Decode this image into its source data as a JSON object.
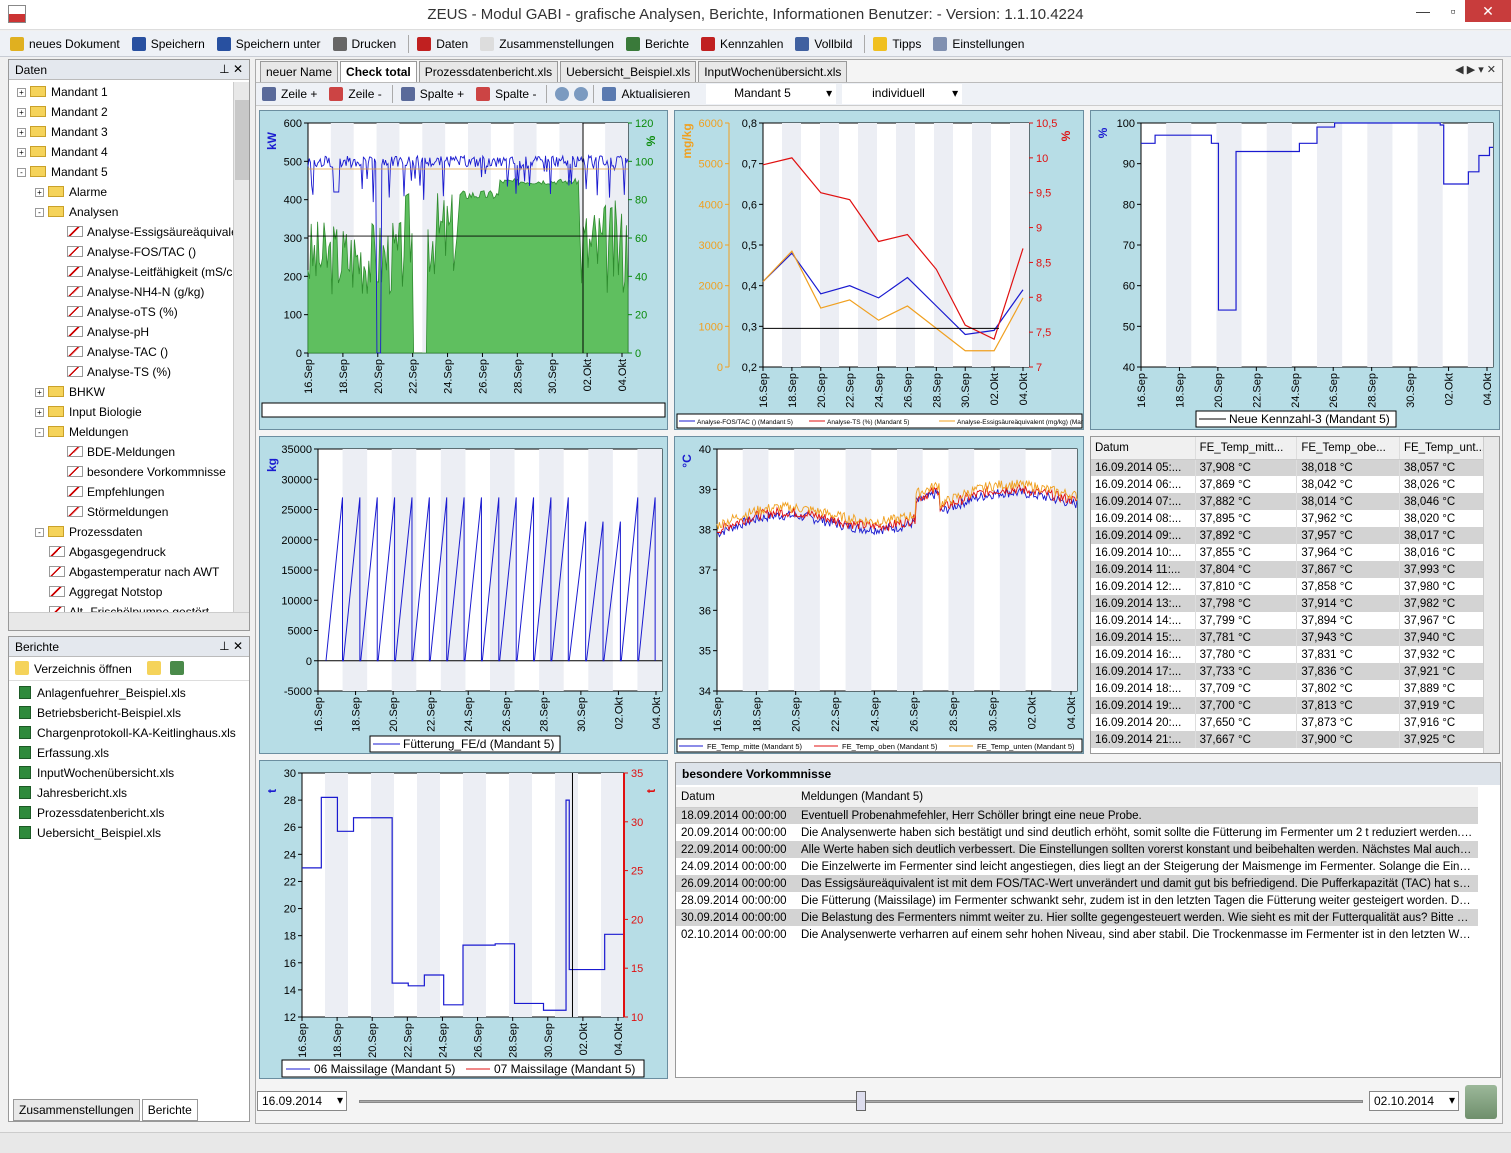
{
  "window": {
    "title": "ZEUS - Modul GABI - grafische Analysen, Berichte, Informationen Benutzer:  - Version: 1.1.10.4224"
  },
  "toolbar": [
    {
      "label": "neues Dokument",
      "color": "#e0b020"
    },
    {
      "label": "Speichern",
      "color": "#2850a0"
    },
    {
      "label": "Speichern unter",
      "color": "#2850a0"
    },
    {
      "label": "Drucken",
      "color": "#666"
    },
    {
      "label": "Daten",
      "color": "#c02020"
    },
    {
      "label": "Zusammenstellungen",
      "color": "#ddd"
    },
    {
      "label": "Berichte",
      "color": "#3a7a3a"
    },
    {
      "label": "Kennzahlen",
      "color": "#c02020"
    },
    {
      "label": "Vollbild",
      "color": "#4060a0"
    },
    {
      "label": "Tipps",
      "color": "#f0c020"
    },
    {
      "label": "Einstellungen",
      "color": "#8090b0"
    }
  ],
  "daten": {
    "title": "Daten",
    "items": [
      {
        "label": "Mandant 1",
        "lvl": 0,
        "type": "folder",
        "exp": "+"
      },
      {
        "label": "Mandant 2",
        "lvl": 0,
        "type": "folder",
        "exp": "+"
      },
      {
        "label": "Mandant 3",
        "lvl": 0,
        "type": "folder",
        "exp": "+"
      },
      {
        "label": "Mandant 4",
        "lvl": 0,
        "type": "folder",
        "exp": "+"
      },
      {
        "label": "Mandant 5",
        "lvl": 0,
        "type": "folder",
        "exp": "-"
      },
      {
        "label": "Alarme",
        "lvl": 1,
        "type": "folder",
        "exp": "+"
      },
      {
        "label": "Analysen",
        "lvl": 1,
        "type": "folder",
        "exp": "-"
      },
      {
        "label": "Analyse-Essigsäureäquivalent",
        "lvl": 2,
        "type": "chart"
      },
      {
        "label": "Analyse-FOS/TAC ()",
        "lvl": 2,
        "type": "chart"
      },
      {
        "label": "Analyse-Leitfähigkeit (mS/cm)",
        "lvl": 2,
        "type": "chart"
      },
      {
        "label": "Analyse-NH4-N (g/kg)",
        "lvl": 2,
        "type": "chart"
      },
      {
        "label": "Analyse-oTS (%)",
        "lvl": 2,
        "type": "chart"
      },
      {
        "label": "Analyse-pH",
        "lvl": 2,
        "type": "chart"
      },
      {
        "label": "Analyse-TAC ()",
        "lvl": 2,
        "type": "chart"
      },
      {
        "label": "Analyse-TS (%)",
        "lvl": 2,
        "type": "chart"
      },
      {
        "label": "BHKW",
        "lvl": 1,
        "type": "folder",
        "exp": "+"
      },
      {
        "label": "Input Biologie",
        "lvl": 1,
        "type": "folder",
        "exp": "+"
      },
      {
        "label": "Meldungen",
        "lvl": 1,
        "type": "folder",
        "exp": "-"
      },
      {
        "label": "BDE-Meldungen",
        "lvl": 2,
        "type": "chart"
      },
      {
        "label": "besondere Vorkommnisse",
        "lvl": 2,
        "type": "chart"
      },
      {
        "label": "Empfehlungen",
        "lvl": 2,
        "type": "chart"
      },
      {
        "label": "Störmeldungen",
        "lvl": 2,
        "type": "chart"
      },
      {
        "label": "Prozessdaten",
        "lvl": 1,
        "type": "folder",
        "exp": "-"
      },
      {
        "label": "Abgasgegendruck",
        "lvl": 1,
        "type": "chart"
      },
      {
        "label": "Abgastemperatur nach AWT",
        "lvl": 1,
        "type": "chart"
      },
      {
        "label": "Aggregat Notstop",
        "lvl": 1,
        "type": "chart"
      },
      {
        "label": "Alt- Frischölpumpe gestört",
        "lvl": 1,
        "type": "chart"
      }
    ]
  },
  "berichte": {
    "title": "Berichte",
    "open_label": "Verzeichnis öffnen",
    "files": [
      "Anlagenfuehrer_Beispiel.xls",
      "Betriebsbericht-Beispiel.xls",
      "Chargenprotokoll-KA-Keitlinghaus.xls",
      "Erfassung.xls",
      "InputWochenübersicht.xls",
      "Jahresbericht.xls",
      "Prozessdatenbericht.xls",
      "Uebersicht_Beispiel.xls"
    ],
    "bottom_tabs": [
      "Zusammenstellungen",
      "Berichte"
    ]
  },
  "doc_tabs": [
    "neuer Name",
    "Check total",
    "Prozessdatenbericht.xls",
    "Uebersicht_Beispiel.xls",
    "InputWochenübersicht.xls"
  ],
  "sub_toolbar": {
    "zeile_plus": "Zeile +",
    "zeile_minus": "Zeile -",
    "spalte_plus": "Spalte +",
    "spalte_minus": "Spalte -",
    "refresh": "Aktualisieren",
    "mandant": "Mandant 5",
    "mode": "individuell"
  },
  "chart_data": [
    {
      "type": "line",
      "title": "",
      "ylabel": "kW",
      "y2label": "%",
      "ylim": [
        0,
        600
      ],
      "y2lim": [
        0,
        120
      ],
      "x": [
        "16.Sep",
        "18.Sep",
        "20.Sep",
        "22.Sep",
        "24.Sep",
        "26.Sep",
        "28.Sep",
        "30.Sep",
        "02.Okt",
        "04.Okt"
      ],
      "yticks": [
        0,
        100,
        200,
        300,
        400,
        500,
        600
      ],
      "y2ticks": [
        0,
        20,
        40,
        60,
        80,
        100,
        120
      ]
    },
    {
      "type": "line",
      "ylabel": "mg/kg",
      "ylim": [
        0,
        6000
      ],
      "y2lim": [
        0.2,
        0.8
      ],
      "y3label": "%",
      "y3lim": [
        7,
        10.5
      ],
      "yticks": [
        0,
        1000,
        2000,
        3000,
        4000,
        5000,
        6000
      ],
      "y2ticks": [
        "0,2",
        "0,3",
        "0,4",
        "0,5",
        "0,6",
        "0,7",
        "0,8"
      ],
      "y3ticks": [
        "7",
        "7,5",
        "8",
        "8,5",
        "9",
        "9,5",
        "10",
        "10,5"
      ],
      "x": [
        "16.Sep",
        "18.Sep",
        "20.Sep",
        "22.Sep",
        "24.Sep",
        "26.Sep",
        "28.Sep",
        "30.Sep",
        "02.Okt",
        "04.Okt"
      ],
      "series": [
        {
          "name": "Analyse-FOS/TAC () (Mandant 5)",
          "color": "#1a1ad0",
          "values": [
            0.41,
            0.48,
            0.38,
            0.4,
            0.37,
            0.42,
            0.35,
            0.28,
            0.29,
            0.39
          ]
        },
        {
          "name": "Analyse-TS (%) (Mandant 5)",
          "color": "#e01010",
          "values": [
            9.9,
            10,
            9.5,
            9.4,
            8.8,
            8.9,
            8.4,
            7.6,
            7.4,
            8.7
          ]
        },
        {
          "name": "Analyse-Essigsäureäquivalent (mg/kg) (Mandant 5)",
          "color": "#f0a020",
          "values": [
            2100,
            2850,
            1450,
            1650,
            1150,
            1500,
            950,
            400,
            400,
            1700
          ]
        }
      ]
    },
    {
      "type": "line",
      "ylabel": "%",
      "ylim": [
        40,
        100
      ],
      "yticks": [
        40,
        50,
        60,
        70,
        80,
        90,
        100
      ],
      "x": [
        "16.Sep",
        "18.Sep",
        "20.Sep",
        "22.Sep",
        "24.Sep",
        "26.Sep",
        "28.Sep",
        "30.Sep",
        "02.Okt",
        "04.Okt"
      ],
      "series": [
        {
          "name": "Neue Kennzahl-3 (Mandant 5)",
          "color": "#1a1ad0"
        }
      ]
    },
    {
      "type": "line",
      "ylabel": "kg",
      "ylim": [
        -5000,
        35000
      ],
      "yticks": [
        -5000,
        0,
        5000,
        10000,
        15000,
        20000,
        25000,
        30000,
        35000
      ],
      "x": [
        "16.Sep",
        "18.Sep",
        "20.Sep",
        "22.Sep",
        "24.Sep",
        "26.Sep",
        "28.Sep",
        "30.Sep",
        "02.Okt",
        "04.Okt"
      ],
      "series": [
        {
          "name": "Fütterung_FE/d (Mandant 5)",
          "color": "#1a1ad0"
        }
      ]
    },
    {
      "type": "line",
      "ylabel": "°C",
      "ylim": [
        34,
        40
      ],
      "yticks": [
        34,
        35,
        36,
        37,
        38,
        39,
        40
      ],
      "x": [
        "16.Sep",
        "18.Sep",
        "20.Sep",
        "22.Sep",
        "24.Sep",
        "26.Sep",
        "28.Sep",
        "30.Sep",
        "02.Okt",
        "04.Okt"
      ],
      "series": [
        {
          "name": "FE_Temp_mitte (Mandant 5)",
          "color": "#1a1ad0"
        },
        {
          "name": "FE_Temp_oben (Mandant 5)",
          "color": "#e01010"
        },
        {
          "name": "FE_Temp_unten (Mandant 5)",
          "color": "#f0a020"
        }
      ]
    },
    {
      "type": "line",
      "ylabel": "t",
      "y2label": "t",
      "ylim": [
        12,
        30
      ],
      "y2lim": [
        10,
        35
      ],
      "yticks": [
        12,
        14,
        16,
        18,
        20,
        22,
        24,
        26,
        28,
        30
      ],
      "y2ticks": [
        10,
        15,
        20,
        25,
        30,
        35
      ],
      "x": [
        "16.Sep",
        "18.Sep",
        "20.Sep",
        "22.Sep",
        "24.Sep",
        "26.Sep",
        "28.Sep",
        "30.Sep",
        "02.Okt",
        "04.Okt"
      ],
      "series": [
        {
          "name": "06 Maissilage (Mandant 5)",
          "color": "#1a1ad0"
        },
        {
          "name": "07 Maissilage (Mandant 5)",
          "color": "#e01010"
        }
      ]
    }
  ],
  "temp_table": {
    "headers": [
      "Datum",
      "FE_Temp_mitt...",
      "FE_Temp_obe...",
      "FE_Temp_unt..."
    ],
    "rows": [
      [
        "16.09.2014 05:...",
        "37,908 °C",
        "38,018 °C",
        "38,057 °C"
      ],
      [
        "16.09.2014 06:...",
        "37,869 °C",
        "38,042 °C",
        "38,026 °C"
      ],
      [
        "16.09.2014 07:...",
        "37,882 °C",
        "38,014 °C",
        "38,046 °C"
      ],
      [
        "16.09.2014 08:...",
        "37,895 °C",
        "37,962 °C",
        "38,020 °C"
      ],
      [
        "16.09.2014 09:...",
        "37,892 °C",
        "37,957 °C",
        "38,017 °C"
      ],
      [
        "16.09.2014 10:...",
        "37,855 °C",
        "37,964 °C",
        "38,016 °C"
      ],
      [
        "16.09.2014 11:...",
        "37,804 °C",
        "37,867 °C",
        "37,993 °C"
      ],
      [
        "16.09.2014 12:...",
        "37,810 °C",
        "37,858 °C",
        "37,980 °C"
      ],
      [
        "16.09.2014 13:...",
        "37,798 °C",
        "37,914 °C",
        "37,982 °C"
      ],
      [
        "16.09.2014 14:...",
        "37,799 °C",
        "37,894 °C",
        "37,967 °C"
      ],
      [
        "16.09.2014 15:...",
        "37,781 °C",
        "37,943 °C",
        "37,940 °C"
      ],
      [
        "16.09.2014 16:...",
        "37,780 °C",
        "37,831 °C",
        "37,932 °C"
      ],
      [
        "16.09.2014 17:...",
        "37,733 °C",
        "37,836 °C",
        "37,921 °C"
      ],
      [
        "16.09.2014 18:...",
        "37,709 °C",
        "37,802 °C",
        "37,889 °C"
      ],
      [
        "16.09.2014 19:...",
        "37,700 °C",
        "37,813 °C",
        "37,919 °C"
      ],
      [
        "16.09.2014 20:...",
        "37,650 °C",
        "37,873 °C",
        "37,916 °C"
      ],
      [
        "16.09.2014 21:...",
        "37,667 °C",
        "37,900 °C",
        "37,925 °C"
      ]
    ]
  },
  "vorkommnisse": {
    "title": "besondere Vorkommnisse",
    "headers": [
      "Datum",
      "Meldungen (Mandant 5)"
    ],
    "rows": [
      [
        "18.09.2014 00:00:00",
        "Eventuell Probenahmefehler, Herr Schöller bringt eine neue Probe."
      ],
      [
        "20.09.2014 00:00:00",
        "Die Analysenwerte haben sich bestätigt und sind deutlich erhöht, somit sollte die Fütterung im Fermenter um 2 t reduziert werden. Um in ..."
      ],
      [
        "22.09.2014 00:00:00",
        "Alle Werte haben sich deutlich verbessert. Die Einstellungen sollten vorerst konstant und beibehalten werden. Nächstes Mal auch den Na..."
      ],
      [
        "24.09.2014 00:00:00",
        "Die Einzelwerte im Fermenter sind leicht angestiegen, dies liegt an der Steigerung der Maismenge im Fermenter. Solange die Einzelwerte ..."
      ],
      [
        "26.09.2014 00:00:00",
        "Das Essigsäureäquivalent ist mit dem FOS/TAC-Wert unverändert und damit gut bis befriedigend. Die Pufferkapazität (TAC) hat sich weit..."
      ],
      [
        "28.09.2014 00:00:00",
        "Die Fütterung (Maissilage) im Fermenter schwankt sehr, zudem ist in den letzten Tagen die Fütterung weiter gesteigert worden. Die Fütt..."
      ],
      [
        "30.09.2014 00:00:00",
        "Die Belastung des Fermenters nimmt weiter zu. Hier sollte gegengesteuert werden. Wie sieht es mit der Futterqualität aus? Bitte mit M. K..."
      ],
      [
        "02.10.2014 00:00:00",
        "Die Analysenwerte verharren auf einem sehr hohen Niveau, sind aber stabil. Die Trockenmasse im Fermenter ist in den letzten Wochen u..."
      ]
    ]
  },
  "timeline": {
    "start": "16.09.2014",
    "end": "02.10.2014"
  }
}
